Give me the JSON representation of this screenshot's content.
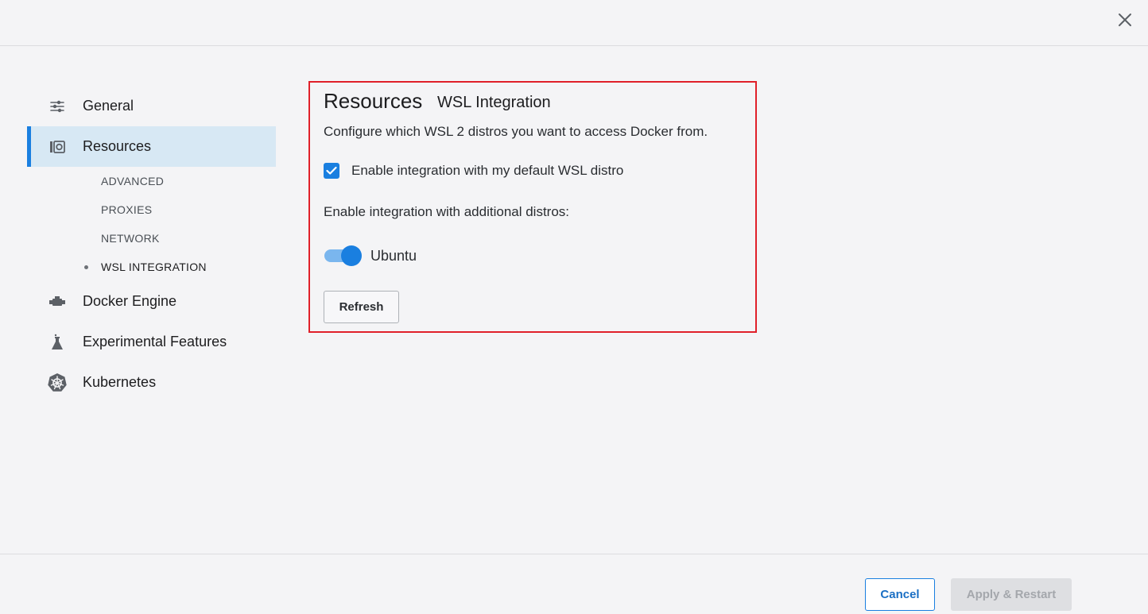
{
  "window": {
    "close_icon": "close-icon"
  },
  "sidebar": {
    "items": [
      {
        "label": "General",
        "icon": "sliders-icon"
      },
      {
        "label": "Resources",
        "icon": "resources-icon",
        "active": true
      },
      {
        "label": "Docker Engine",
        "icon": "engine-icon"
      },
      {
        "label": "Experimental Features",
        "icon": "flask-icon"
      },
      {
        "label": "Kubernetes",
        "icon": "helm-wheel-icon"
      }
    ],
    "resources_sub_items": [
      {
        "label": "ADVANCED"
      },
      {
        "label": "PROXIES"
      },
      {
        "label": "NETWORK"
      },
      {
        "label": "WSL INTEGRATION",
        "current": true
      }
    ]
  },
  "main": {
    "title": "Resources",
    "subtitle": "WSL Integration",
    "description": "Configure which WSL 2 distros you want to access Docker from.",
    "default_distro_checkbox": {
      "label": "Enable integration with my default WSL distro",
      "checked": true
    },
    "additional_distros_label": "Enable integration with additional distros:",
    "distros": [
      {
        "name": "Ubuntu",
        "enabled": true
      }
    ],
    "refresh_label": "Refresh"
  },
  "footer": {
    "cancel_label": "Cancel",
    "apply_label": "Apply & Restart",
    "apply_enabled": false
  },
  "colors": {
    "accent": "#1a7fe0",
    "active_nav_bg": "#d7e8f4",
    "highlight_border": "#e0202a",
    "background": "#f4f4f6"
  }
}
